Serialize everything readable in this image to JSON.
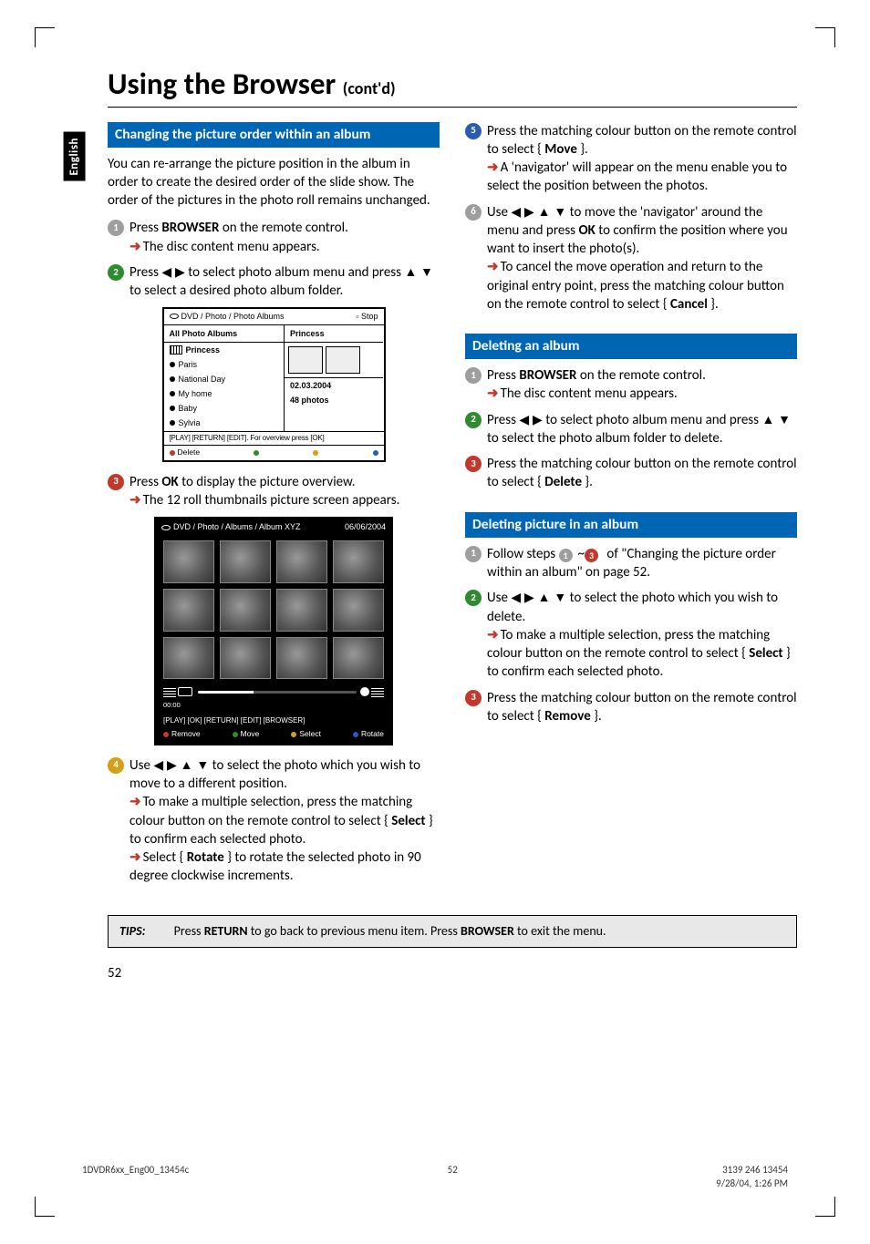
{
  "side_tab": "English",
  "title_main": "Using the Browser",
  "title_contd": "(cont'd)",
  "left": {
    "sec1": {
      "heading": "Changing the picture order within an album",
      "intro": "You can re-arrange the picture position in the album in order to create the desired order of the slide show.  The order of the pictures in the photo roll remains unchanged.",
      "s1a": "Press ",
      "s1b": "BROWSER",
      "s1c": " on the remote control.",
      "s1r": "The disc content menu appears.",
      "s2a": "Press ",
      "s2b": " to select photo album menu and press ",
      "s2c": " to select a desired photo album folder.",
      "s3a": "Press ",
      "s3b": "OK",
      "s3c": " to display the picture overview.",
      "s3r": "The 12 roll thumbnails picture screen appears.",
      "s4a": "Use ",
      "s4b": " to select the photo which you wish to move to a different position.",
      "s4r1a": "To make a multiple selection, press the matching colour button on the remote control to select { ",
      "s4r1b": "Select",
      "s4r1c": " } to confirm each selected photo.",
      "s4r2a": "Select { ",
      "s4r2b": "Rotate",
      "s4r2c": " } to rotate the selected photo in 90 degree clockwise increments."
    },
    "shot1": {
      "crumb": "DVD / Photo / Photo Albums",
      "stop": "Stop",
      "left_hdr": "All Photo Albums",
      "right_hdr": "Princess",
      "items": [
        "Princess",
        "Paris",
        "National Day",
        "My home",
        "Baby",
        "Sylvia"
      ],
      "date": "02.03.2004",
      "count": "48 photos",
      "help": "[PLAY] [RETURN] [EDIT].  For overview press [OK]",
      "action": "Delete"
    },
    "shot2": {
      "crumb": "DVD / Photo / Albums / Album XYZ",
      "date": "06/06/2004",
      "tc": "00:00",
      "help": "[PLAY] [OK] [RETURN] [EDIT] [BROWSER]",
      "a1": "Remove",
      "a2": "Move",
      "a3": "Select",
      "a4": "Rotate"
    }
  },
  "right": {
    "s5a": "Press the matching colour button on the remote control to select { ",
    "s5b": "Move",
    "s5c": " }.",
    "s5r": "A 'navigator' will appear on the menu enable you to select the position between the photos.",
    "s6a": "Use ",
    "s6b": " to move the 'navigator' around the menu and press ",
    "s6c": "OK",
    "s6d": " to confirm the position where you want to insert the photo(s).",
    "s6r1": "To cancel the move operation and return to the original entry point, press the matching colour button on the remote control to select { ",
    "s6r1b": "Cancel",
    "s6r1c": " }.",
    "sec2": {
      "heading": "Deleting an album",
      "s1a": "Press ",
      "s1b": "BROWSER",
      "s1c": " on the remote control.",
      "s1r": "The disc content menu appears.",
      "s2a": "Press ",
      "s2b": " to select photo album menu and press ",
      "s2c": " to select the photo album folder to delete.",
      "s3a": "Press the matching colour button on the remote control to select { ",
      "s3b": "Delete",
      "s3c": " }."
    },
    "sec3": {
      "heading": "Deleting picture in an album",
      "s1a": "Follow steps ",
      "s1b": " of \"Changing the picture order within an album\" on page 52.",
      "s2a": "Use ",
      "s2b": " to select the photo which you wish to delete.",
      "s2r1a": "To make a multiple selection, press the matching colour button on the remote control to select { ",
      "s2r1b": "Select",
      "s2r1c": " } to confirm each selected photo.",
      "s3a": "Press the matching colour button on the remote control to select { ",
      "s3b": "Remove",
      "s3c": " }."
    }
  },
  "nav": {
    "lr": "◀ ▶",
    "ud": "▲ ▼",
    "all": "◀ ▶ ▲ ▼",
    "tilde": "~"
  },
  "tips": {
    "label": "TIPS:",
    "text_a": "Press ",
    "text_b": "RETURN",
    "text_c": " to go back to previous menu item.  Press ",
    "text_d": "BROWSER",
    "text_e": " to exit the menu."
  },
  "pagenum": "52",
  "footer": {
    "left": "1DVDR6xx_Eng00_13454c",
    "center": "52",
    "r1": "3139 246 13454",
    "r2": "9/28/04, 1:26 PM"
  }
}
